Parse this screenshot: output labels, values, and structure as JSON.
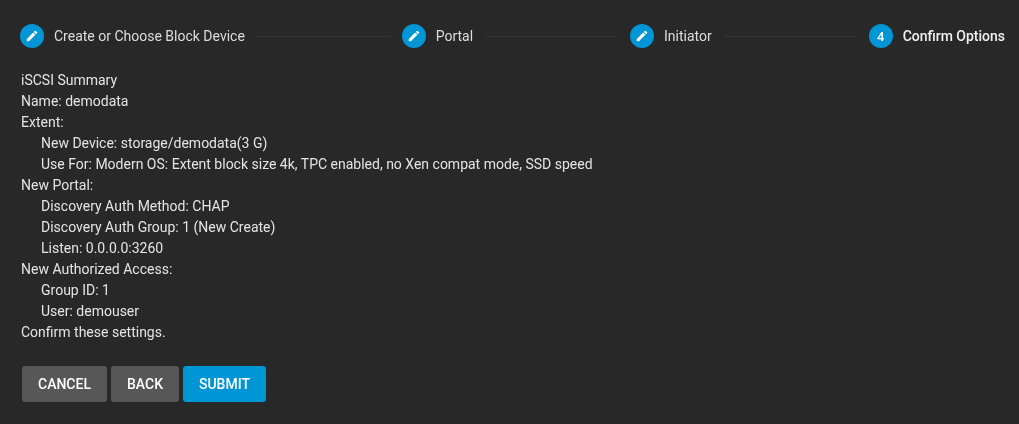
{
  "steps": [
    {
      "kind": "edit",
      "label": "Create or Choose Block Device",
      "selected": false
    },
    {
      "kind": "edit",
      "label": "Portal",
      "selected": false
    },
    {
      "kind": "edit",
      "label": "Initiator",
      "selected": false
    },
    {
      "kind": "number",
      "number": "4",
      "label": "Confirm Options",
      "selected": true
    }
  ],
  "summary": [
    {
      "text": "iSCSI Summary"
    },
    {
      "text": "Name: demodata"
    },
    {
      "text": "Extent:",
      "children": [
        {
          "text": "New Device: storage/demodata(3 G)"
        },
        {
          "text": "Use For: Modern OS: Extent block size 4k, TPC enabled, no Xen compat mode, SSD speed"
        }
      ]
    },
    {
      "text": "New Portal:",
      "children": [
        {
          "text": "Discovery Auth Method: CHAP"
        },
        {
          "text": "Discovery Auth Group: 1 (New Create)"
        },
        {
          "text": "Listen: 0.0.0.0:3260"
        }
      ]
    },
    {
      "text": "New Authorized Access:",
      "children": [
        {
          "text": "Group ID: 1"
        },
        {
          "text": "User: demouser"
        }
      ]
    },
    {
      "text": "Confirm these settings."
    }
  ],
  "buttons": [
    {
      "label": "CANCEL",
      "kind": "secondary"
    },
    {
      "label": "BACK",
      "kind": "secondary"
    },
    {
      "label": "SUBMIT",
      "kind": "primary"
    }
  ]
}
